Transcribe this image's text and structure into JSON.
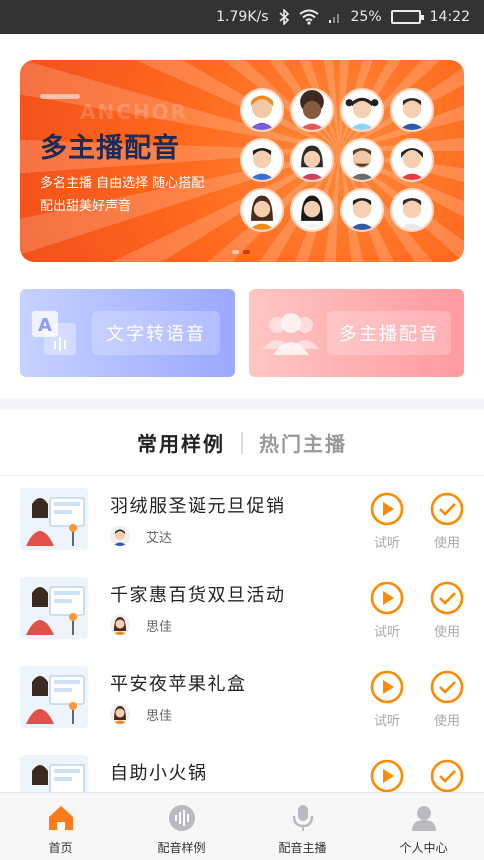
{
  "status_bar": {
    "network_speed": "1.79K/s",
    "battery": "25%",
    "battery_level": 0.25,
    "time": "14:22",
    "icons": [
      "bluetooth-icon",
      "wifi-icon",
      "signal-icon",
      "battery-icon"
    ]
  },
  "banner": {
    "ghost_text": "ANCHOR",
    "title": "多主播配音",
    "subtitle_line1": "多名主播  自由选择  随心搭配",
    "subtitle_line2": "配出甜美好声音",
    "slide_count": 2,
    "active_slide": 2
  },
  "features": {
    "tts_label": "文字转语音",
    "multi_label": "多主播配音"
  },
  "tabs": [
    {
      "label": "常用样例",
      "active": true
    },
    {
      "label": "热门主播",
      "active": false
    }
  ],
  "samples": [
    {
      "title": "羽绒服圣诞元旦促销",
      "author": "艾达",
      "author_gender": "male"
    },
    {
      "title": "千家惠百货双旦活动",
      "author": "思佳",
      "author_gender": "female"
    },
    {
      "title": "平安夜苹果礼盒",
      "author": "思佳",
      "author_gender": "female"
    },
    {
      "title": "自助小火锅",
      "author": "",
      "author_gender": ""
    }
  ],
  "actions": {
    "preview_label": "试听",
    "use_label": "使用"
  },
  "nav": [
    {
      "label": "首页",
      "icon": "home-icon",
      "active": true
    },
    {
      "label": "配音样例",
      "icon": "waveform-icon",
      "active": false
    },
    {
      "label": "配音主播",
      "icon": "microphone-icon",
      "active": false
    },
    {
      "label": "个人中心",
      "icon": "person-icon",
      "active": false
    }
  ],
  "colors": {
    "accent": "#ff8a00",
    "banner": "#ff6a1e",
    "title_dark": "#1f2a55",
    "tts_card": "#9aa8ff",
    "multi_card": "#ff9aa0"
  }
}
